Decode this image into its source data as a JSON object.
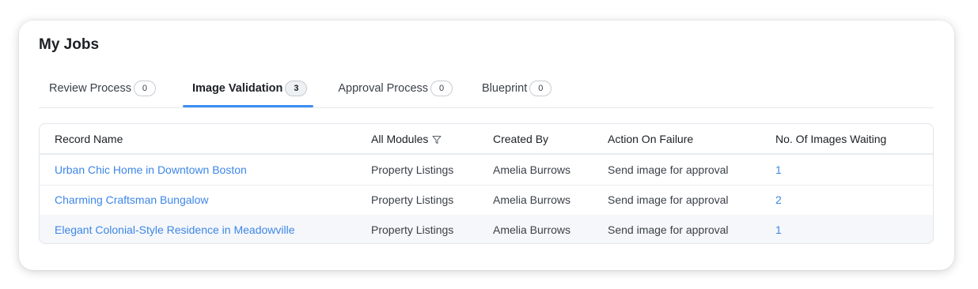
{
  "page": {
    "title": "My Jobs"
  },
  "tabs": [
    {
      "label": "Review Process",
      "count": "0",
      "active": false
    },
    {
      "label": "Image Validation",
      "count": "3",
      "active": true
    },
    {
      "label": "Approval Process",
      "count": "0",
      "active": false
    },
    {
      "label": "Blueprint",
      "count": "0",
      "active": false
    }
  ],
  "table": {
    "columns": [
      "Record Name",
      "All Modules",
      "Created By",
      "Action On Failure",
      "No. Of Images Waiting"
    ],
    "filter_icon": "filter-icon",
    "rows": [
      {
        "record_name": "Urban Chic Home in Downtown Boston",
        "module": "Property Listings",
        "created_by": "Amelia Burrows",
        "action_on_failure": "Send image for approval",
        "images_waiting": "1"
      },
      {
        "record_name": "Charming Craftsman Bungalow",
        "module": "Property Listings",
        "created_by": "Amelia Burrows",
        "action_on_failure": "Send image for approval",
        "images_waiting": "2"
      },
      {
        "record_name": "Elegant Colonial-Style Residence in Meadowville",
        "module": "Property Listings",
        "created_by": "Amelia Burrows",
        "action_on_failure": "Send image for approval",
        "images_waiting": "1"
      }
    ]
  },
  "colors": {
    "accent": "#3d8ff5",
    "link": "#3d86e8",
    "text": "#1c1f24",
    "hover_row": "#f5f7fa"
  }
}
